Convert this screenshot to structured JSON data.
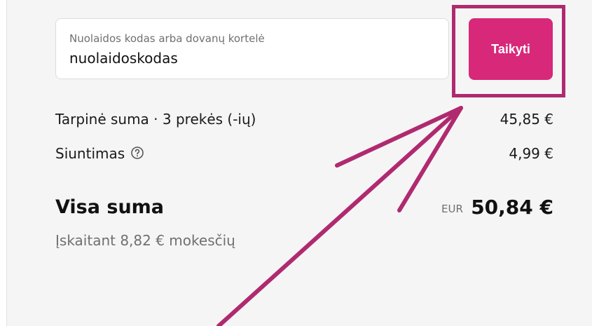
{
  "discount": {
    "placeholder": "Nuolaidos kodas arba dovanų kortelė",
    "value": "nuolaidoskodas",
    "apply_label": "Taikyti"
  },
  "summary": {
    "subtotal_label": "Tarpinė suma · 3 prekės (-ių)",
    "subtotal_value": "45,85 €",
    "shipping_label": "Siuntimas",
    "shipping_value": "4,99 €",
    "total_label": "Visa suma",
    "currency": "EUR",
    "total_value": "50,84 €",
    "tax_note": "Įskaitant 8,82 € mokesčių"
  },
  "annotation": {
    "color": "#b02a70"
  },
  "icons": {
    "shipping_help": "help-circle-icon"
  },
  "colors": {
    "button": "#d8287a",
    "background": "#f5f5f5"
  }
}
